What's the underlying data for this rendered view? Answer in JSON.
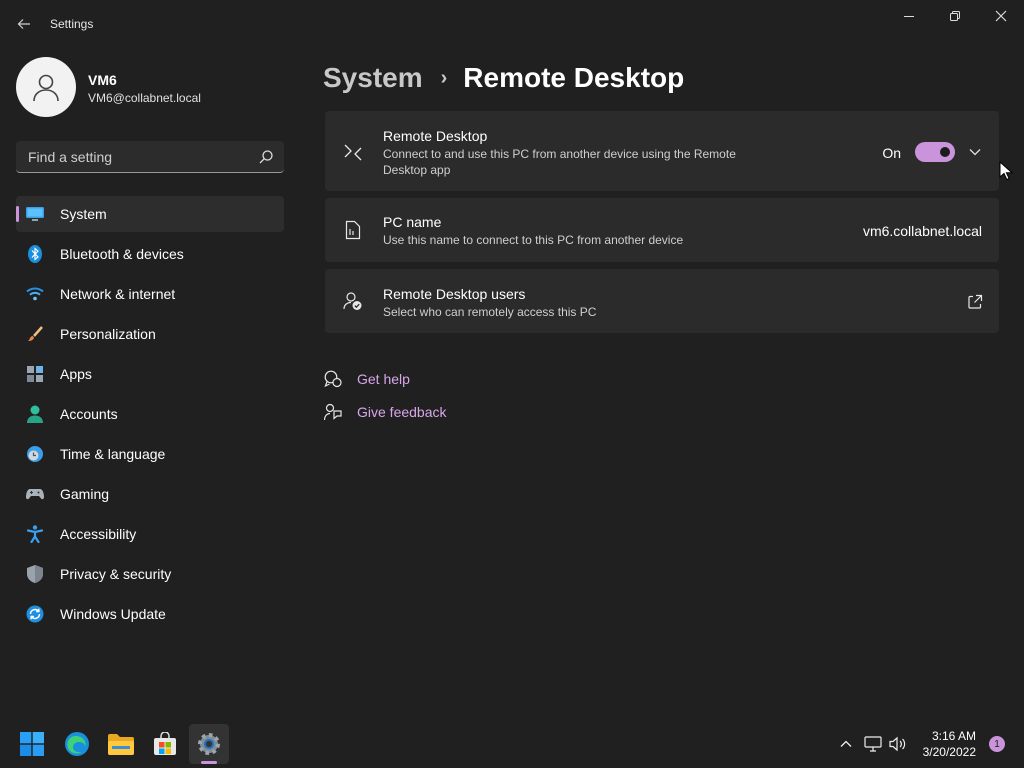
{
  "window": {
    "title": "Settings",
    "back_icon": "back-arrow-icon",
    "controls": [
      "minimize-icon",
      "restore-icon",
      "close-icon"
    ]
  },
  "profile": {
    "name": "VM6",
    "email": "VM6@collabnet.local",
    "avatar_icon": "user-avatar-icon"
  },
  "search": {
    "placeholder": "Find a setting",
    "value": "",
    "icon": "search-icon"
  },
  "nav": {
    "items": [
      {
        "label": "System",
        "icon": "monitor-icon",
        "active": true
      },
      {
        "label": "Bluetooth & devices",
        "icon": "bluetooth-icon"
      },
      {
        "label": "Network & internet",
        "icon": "wifi-icon"
      },
      {
        "label": "Personalization",
        "icon": "brush-icon"
      },
      {
        "label": "Apps",
        "icon": "apps-icon"
      },
      {
        "label": "Accounts",
        "icon": "accounts-icon"
      },
      {
        "label": "Time & language",
        "icon": "clock-globe-icon"
      },
      {
        "label": "Gaming",
        "icon": "gamepad-icon"
      },
      {
        "label": "Accessibility",
        "icon": "accessibility-icon"
      },
      {
        "label": "Privacy & security",
        "icon": "shield-icon"
      },
      {
        "label": "Windows Update",
        "icon": "update-icon"
      }
    ]
  },
  "header": {
    "parent": "System",
    "separator": "›",
    "current": "Remote Desktop"
  },
  "cards": {
    "remote_desktop": {
      "title": "Remote Desktop",
      "description": "Connect to and use this PC from another device using the Remote Desktop app",
      "toggle_label": "On",
      "toggle_on": true,
      "icon": "remote-desktop-icon"
    },
    "pc_name": {
      "title": "PC name",
      "description": "Use this name to connect to this PC from another device",
      "value": "vm6.collabnet.local",
      "icon": "pc-document-icon"
    },
    "users": {
      "title": "Remote Desktop users",
      "description": "Select who can remotely access this PC",
      "icon": "user-check-icon",
      "action_icon": "open-external-icon"
    }
  },
  "help": {
    "get_help": "Get help",
    "give_feedback": "Give feedback"
  },
  "taskbar": {
    "apps": [
      "start-icon",
      "edge-icon",
      "file-explorer-icon",
      "store-icon",
      "settings-icon"
    ],
    "active_app": "settings-icon",
    "time": "3:16 AM",
    "date": "3/20/2022",
    "notification_count": "1"
  },
  "colors": {
    "accent": "#c994d9",
    "background": "#202020",
    "card": "#2b2b2b",
    "link": "#d7a6ea"
  }
}
